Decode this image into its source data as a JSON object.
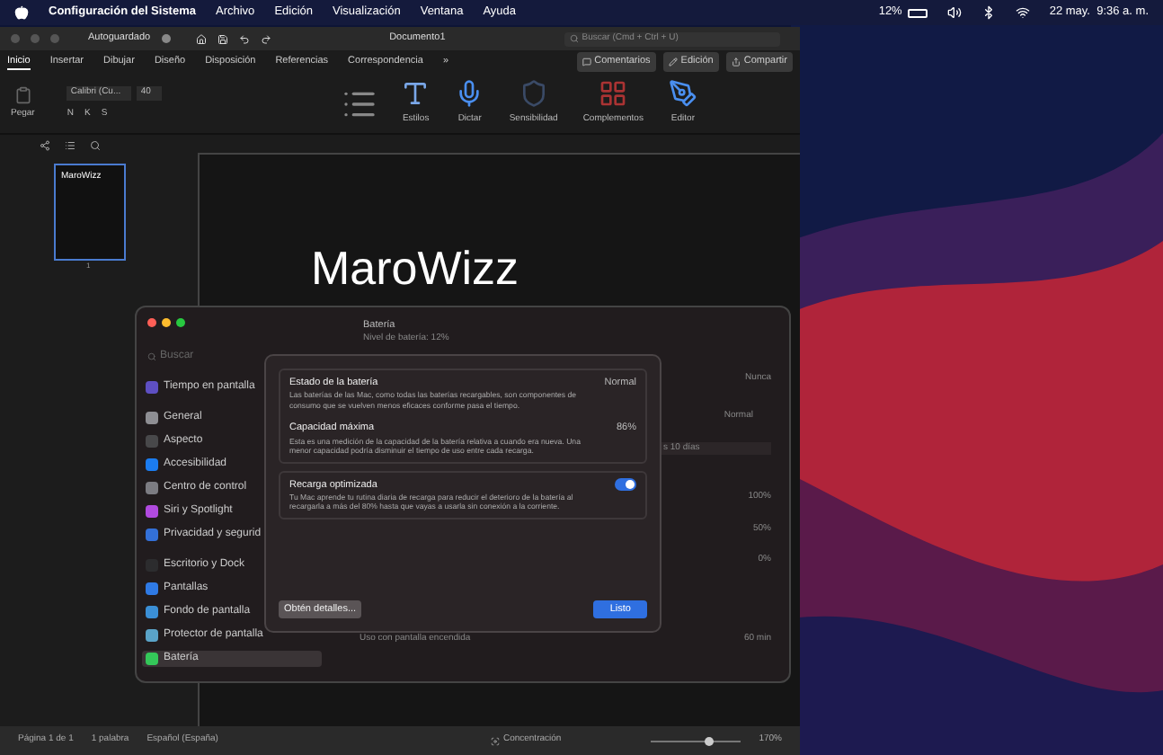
{
  "menubar": {
    "app": "Configuración del Sistema",
    "items": [
      "Archivo",
      "Edición",
      "Visualización",
      "Ventana",
      "Ayuda"
    ],
    "battery": "12%",
    "datetime": "22 may.  9:36 a. m."
  },
  "word": {
    "autosave": "Autoguardado",
    "autosave_on": false,
    "title": "Documento1",
    "search": {
      "placeholder": "Buscar (Cmd + Ctrl + U)"
    },
    "tabs": [
      {
        "label": "Inicio",
        "selected": true
      },
      {
        "label": "Insertar",
        "selected": false
      },
      {
        "label": "Dibujar",
        "selected": false
      },
      {
        "label": "Diseño",
        "selected": false
      },
      {
        "label": "Disposición",
        "selected": false
      },
      {
        "label": "Referencias",
        "selected": false
      },
      {
        "label": "Correspondencia",
        "selected": false
      }
    ],
    "more": "»",
    "comments": "Comentarios",
    "editing": "Edición",
    "share": "Compartir",
    "ribbon": {
      "paste": "Pegar",
      "font": "Calibri (Cu...",
      "size": "40",
      "format": [
        "N",
        "K",
        "S"
      ],
      "big_buttons": [
        {
          "label": "Estilos",
          "kind": "styles"
        },
        {
          "label": "Dictar",
          "kind": "mic"
        },
        {
          "label": "Sensibilidad",
          "kind": "shield"
        },
        {
          "label": "Complementos",
          "kind": "grid"
        },
        {
          "label": "Editor",
          "kind": "pen"
        }
      ]
    },
    "thumbnail": {
      "text": "MaroWizz",
      "page": "1"
    },
    "document_text": "MaroWizz",
    "status": [
      "Página 1 de 1",
      "1 palabra",
      "Español (España)"
    ],
    "focus": "Concentración",
    "zoom": {
      "level": 0.6,
      "reading": "170%"
    }
  },
  "settings": {
    "search": {
      "placeholder": "Buscar"
    },
    "groups": [
      [
        {
          "label": "Tiempo en pantalla",
          "color": "#5e4fc2",
          "selected": false
        }
      ],
      [
        {
          "label": "General",
          "color": "#8e8e93",
          "selected": false
        },
        {
          "label": "Aspecto",
          "color": "#48484a",
          "selected": false
        },
        {
          "label": "Accesibilidad",
          "color": "#1b7cf0",
          "selected": false
        },
        {
          "label": "Centro de control",
          "color": "#7c7c82",
          "selected": false
        },
        {
          "label": "Siri y Spotlight",
          "color": "#b04adf",
          "selected": false
        },
        {
          "label": "Privacidad y segurid",
          "color": "#3370d8",
          "selected": false
        }
      ],
      [
        {
          "label": "Escritorio y Dock",
          "color": "#2c2c2e",
          "selected": false
        },
        {
          "label": "Pantallas",
          "color": "#2f7ae5",
          "selected": false
        },
        {
          "label": "Fondo de pantalla",
          "color": "#3b8fd6",
          "selected": false
        },
        {
          "label": "Protector de pantalla",
          "color": "#5aa3c8",
          "selected": false
        },
        {
          "label": "Batería",
          "color": "#34c759",
          "selected": true
        }
      ]
    ],
    "header": {
      "title": "Batería",
      "subtitle": "Nivel de batería: 12%"
    },
    "values": [
      "Nunca",
      "Normal"
    ],
    "range": "s 10 días",
    "axis": [
      "100%",
      "50%",
      "0%"
    ],
    "usage": "Uso con pantalla encendida",
    "axis2": [
      "60 min"
    ]
  },
  "dialog": {
    "sections": [
      {
        "title": "Estado de la batería",
        "value": "Normal",
        "description": "Las baterías de las Mac, como todas las baterías recargables, son componentes de consumo que se vuelven menos eficaces conforme pasa el tiempo."
      },
      {
        "title": "Capacidad máxima",
        "value": "86%",
        "description": "Esta es una medición de la capacidad de la batería relativa a cuando era nueva. Una menor capacidad podría disminuir el tiempo de uso entre cada recarga."
      }
    ],
    "toggle": {
      "title": "Recarga optimizada",
      "on": true,
      "description": "Tu Mac aprende tu rutina diaria de recarga para reducir el deterioro de la batería al recargarla a más del 80% hasta que vayas a usarla sin conexión a la corriente."
    },
    "details": "Obtén detalles...",
    "done": "Listo"
  }
}
